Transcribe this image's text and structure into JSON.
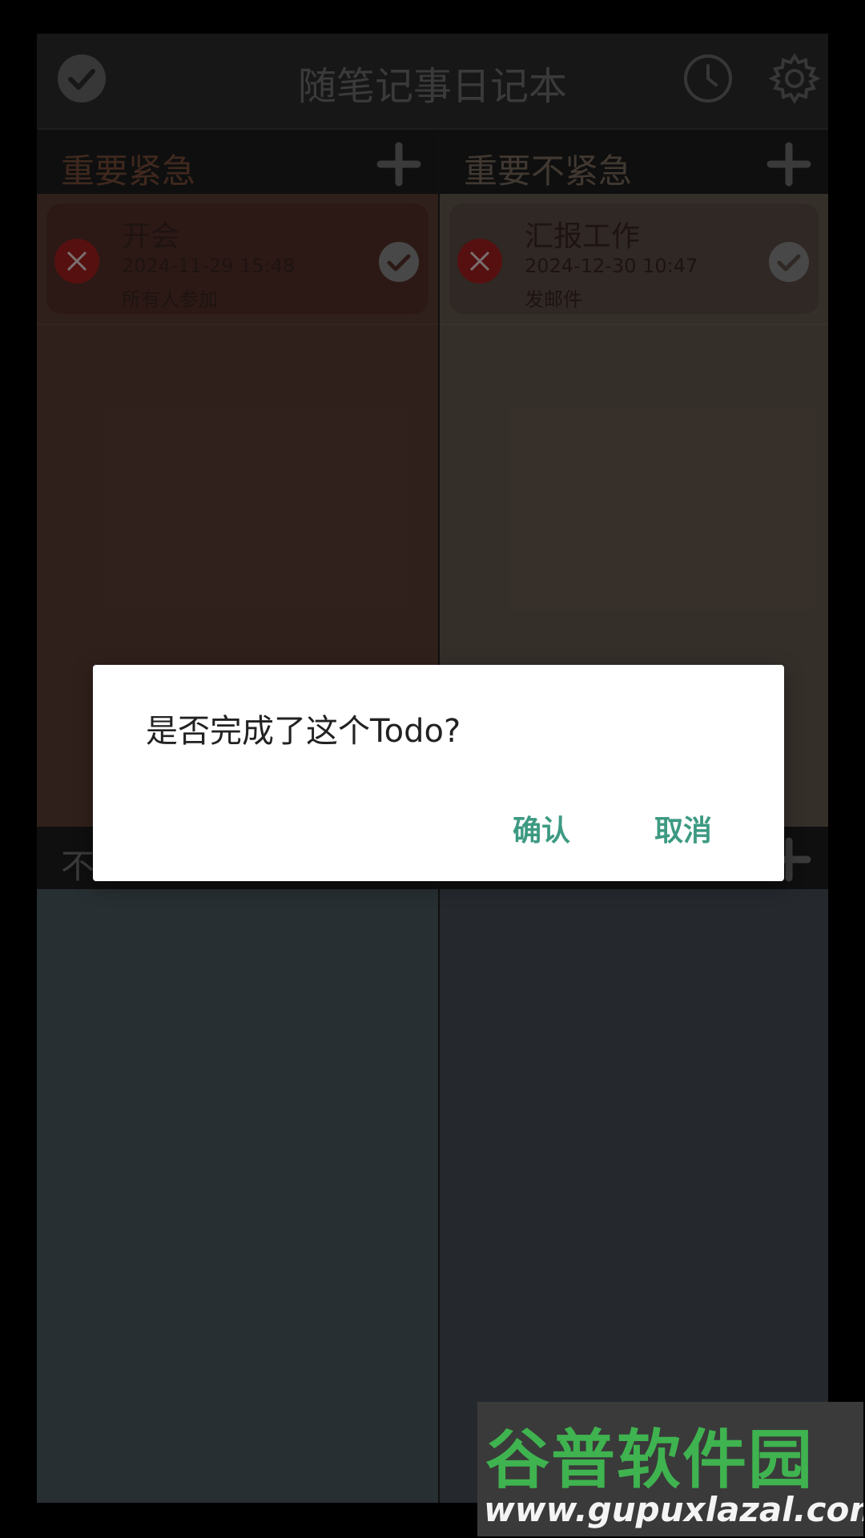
{
  "app": {
    "title": "随笔记事日记本"
  },
  "quadrants": {
    "q1": {
      "label": "重要紧急",
      "color": "#5d3f36",
      "header_label_color": "#7a4e3a"
    },
    "q2": {
      "label": "重要不紧急",
      "color": "#675a51",
      "header_label_color": "#7b6c5f"
    },
    "q3": {
      "label_visible": "不",
      "color": "#4b5a60"
    },
    "q4": {
      "color": "#474f59"
    }
  },
  "tasks": [
    {
      "title": "开会",
      "datetime": "2024-11-29 15:48",
      "note": "所有人参加"
    },
    {
      "title": "汇报工作",
      "datetime": "2024-12-30 10:47",
      "note": "发邮件"
    }
  ],
  "dialog": {
    "message": "是否完成了这个Todo?",
    "confirm_label": "确认",
    "cancel_label": "取消",
    "button_color": "#3d9a82"
  },
  "watermark": {
    "logo_text": "谷普软件园",
    "url_text": "www.gupuxlazal.com"
  },
  "icons": {
    "top_left": "check-circle-icon",
    "history": "clock-icon",
    "settings": "gear-icon",
    "add": "plus-icon",
    "delete": "close-icon",
    "done": "check-icon"
  }
}
